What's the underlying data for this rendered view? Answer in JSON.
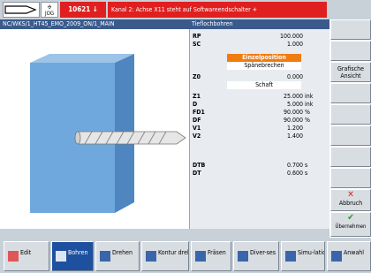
{
  "header": {
    "mode": "JOG",
    "alarm_number": "10621",
    "alarm_message": "Kanal 2: Achse X11 steht auf Softwareendschalter +"
  },
  "path": "NC/WKS/1_HT45_EMO_2009_ON/1_MAIN",
  "form": {
    "title": "Tieflochbohren",
    "params": [
      {
        "label": "RP",
        "value": "100.000",
        "unit": ""
      },
      {
        "label": "SC",
        "value": "1.000",
        "unit": ""
      },
      {
        "label": "",
        "value": "Einzelposition",
        "unit": ""
      },
      {
        "label": "",
        "value": "Spänebrechen",
        "unit": ""
      },
      {
        "label": "Z0",
        "value": "0.000",
        "unit": ""
      },
      {
        "label": "",
        "value": "Schaft",
        "unit": ""
      },
      {
        "label": "Z1",
        "value": "25.000",
        "unit": "ink"
      },
      {
        "label": "D",
        "value": "5.000",
        "unit": "ink"
      },
      {
        "label": "FD1",
        "value": "90.000",
        "unit": "%"
      },
      {
        "label": "DF",
        "value": "90.000",
        "unit": "%"
      },
      {
        "label": "V1",
        "value": "1.200",
        "unit": ""
      },
      {
        "label": "V2",
        "value": "1.400",
        "unit": ""
      },
      {
        "label": "DTB",
        "value": "0.700",
        "unit": "s"
      },
      {
        "label": "DT",
        "value": "0.600",
        "unit": "s"
      }
    ]
  },
  "vertical_softkeys": [
    {
      "label": ""
    },
    {
      "label": ""
    },
    {
      "label": "Grafische Ansicht"
    },
    {
      "label": ""
    },
    {
      "label": ""
    },
    {
      "label": ""
    },
    {
      "label": ""
    },
    {
      "label": ""
    },
    {
      "label": "Abbruch"
    },
    {
      "label": "Übernehmen"
    }
  ],
  "horizontal_softkeys": [
    {
      "label": "Edit"
    },
    {
      "label": "Bohren"
    },
    {
      "label": "Drehen"
    },
    {
      "label": "Kontur drehen"
    },
    {
      "label": "Fräsen"
    },
    {
      "label": "Diver-ses"
    },
    {
      "label": "Simu-lation"
    },
    {
      "label": "Anwahl"
    }
  ],
  "colors": {
    "accent_blue": "#1e50a0",
    "alarm_red": "#e02020",
    "selection_orange": "#f07c10",
    "workpiece_blue": "#6fa8dc"
  },
  "icons": [
    "nc-channel-icon",
    "jog-mode-icon",
    "cancel-x-icon",
    "accept-check-icon"
  ]
}
